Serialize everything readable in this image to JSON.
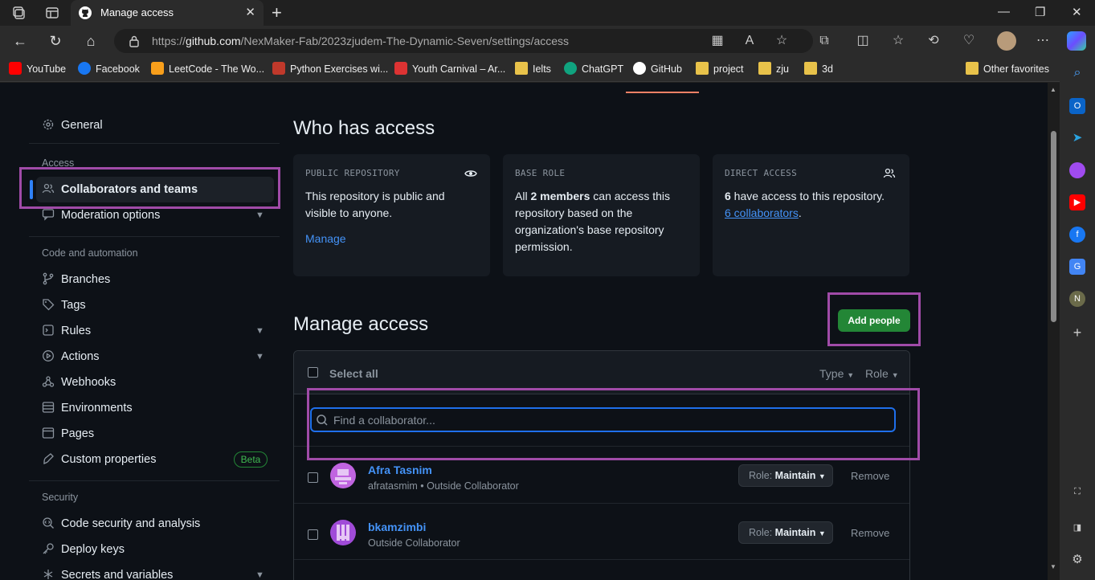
{
  "browser": {
    "tab_title": "Manage access",
    "url_prefix": "https://",
    "url_host": "github.com",
    "url_path": "/NexMaker-Fab/2023zjudem-The-Dynamic-Seven/settings/access",
    "favorites": [
      {
        "label": "YouTube",
        "color": "#ff0000"
      },
      {
        "label": "Facebook",
        "color": "#1877f2"
      },
      {
        "label": "LeetCode - The Wo...",
        "color": "#f89f1b"
      },
      {
        "label": "Python Exercises wi...",
        "color": "#c0392b"
      },
      {
        "label": "Youth Carnival – Ar...",
        "color": "#d33"
      },
      {
        "label": "Ielts",
        "color": "#e8c24a"
      },
      {
        "label": "ChatGPT",
        "color": "#10a37f"
      },
      {
        "label": "GitHub",
        "color": "#ffffff"
      },
      {
        "label": "project",
        "color": "#e8c24a"
      },
      {
        "label": "zju",
        "color": "#e8c24a"
      },
      {
        "label": "3d",
        "color": "#e8c24a"
      }
    ],
    "other_favorites": "Other favorites",
    "profile_initial": "N"
  },
  "sidebar": {
    "general": "General",
    "access_heading": "Access",
    "collaborators": "Collaborators and teams",
    "moderation": "Moderation options",
    "code_heading": "Code and automation",
    "branches": "Branches",
    "tags": "Tags",
    "rules": "Rules",
    "actions": "Actions",
    "webhooks": "Webhooks",
    "environments": "Environments",
    "pages": "Pages",
    "custom_properties": "Custom properties",
    "beta": "Beta",
    "security_heading": "Security",
    "code_security": "Code security and analysis",
    "deploy_keys": "Deploy keys",
    "secrets": "Secrets and variables"
  },
  "who_has_access": {
    "title": "Who has access",
    "public": {
      "label": "PUBLIC REPOSITORY",
      "text": "This repository is public and visible to anyone.",
      "link": "Manage"
    },
    "base_role": {
      "label": "BASE ROLE",
      "text_a": "All ",
      "text_b": "2 members",
      "text_c": " can access this repository based on the organization's base repository permission."
    },
    "direct": {
      "label": "DIRECT ACCESS",
      "text_a": "6",
      "text_b": " have access to this repository. ",
      "link": "6 collaborators",
      "text_c": "."
    }
  },
  "manage_access": {
    "title": "Manage access",
    "add_button": "Add people",
    "select_all": "Select all",
    "type_filter": "Type",
    "role_filter": "Role",
    "search_placeholder": "Find a collaborator...",
    "role_prefix": "Role: ",
    "remove": "Remove",
    "rows": [
      {
        "name": "Afra Tasnim",
        "sub": "afratasmim • Outside Collaborator",
        "role": "Maintain"
      },
      {
        "name": "bkamzimbi",
        "sub": "Outside Collaborator",
        "role": "Maintain"
      }
    ]
  }
}
